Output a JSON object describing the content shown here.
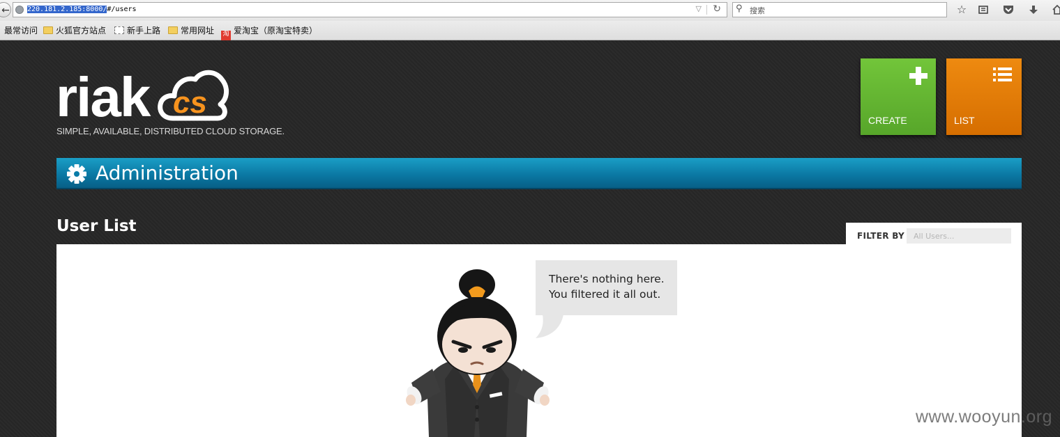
{
  "browser": {
    "url_host": "220.181.2.185:8000/",
    "url_path": "#/users",
    "search_placeholder": "搜索",
    "bookmarks": [
      "最常访问",
      "火狐官方站点",
      "新手上路",
      "常用网址",
      "爱淘宝（原淘宝特卖）"
    ]
  },
  "brand": {
    "logo_text": "riak",
    "tagline": "SIMPLE, AVAILABLE, DISTRIBUTED CLOUD STORAGE."
  },
  "actions": {
    "create_label": "CREATE",
    "list_label": "LIST"
  },
  "header": {
    "title": "Administration"
  },
  "section": {
    "title": "User List"
  },
  "filter": {
    "label": "FILTER BY",
    "placeholder": "All Users..."
  },
  "empty_state": {
    "line1": "There's nothing here.",
    "line2": "You filtered it all out."
  },
  "watermark": "www.wooyun.org",
  "colors": {
    "create_tile": "#63b532",
    "list_tile": "#e27c05",
    "admin_bar": "#0a7ca8",
    "logo_accent": "#f7931e"
  }
}
